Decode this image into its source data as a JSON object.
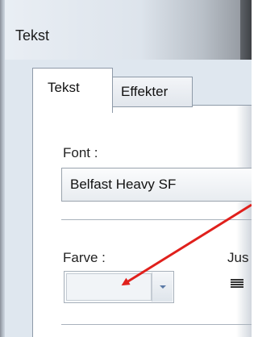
{
  "window": {
    "title": "Tekst"
  },
  "tabs": [
    {
      "label": "Tekst",
      "active": true
    },
    {
      "label": "Effekter",
      "active": false
    }
  ],
  "font": {
    "label": "Font :",
    "selected": "Belfast Heavy SF"
  },
  "color": {
    "label": "Farve :",
    "value": ""
  },
  "justify": {
    "label": "Jus"
  },
  "annotation": {
    "arrow_color": "#e0201c"
  },
  "colors": {
    "tab_border": "#8e9aa8",
    "window_bg": "#dfe6ee",
    "panel_bg": "#ffffff"
  }
}
